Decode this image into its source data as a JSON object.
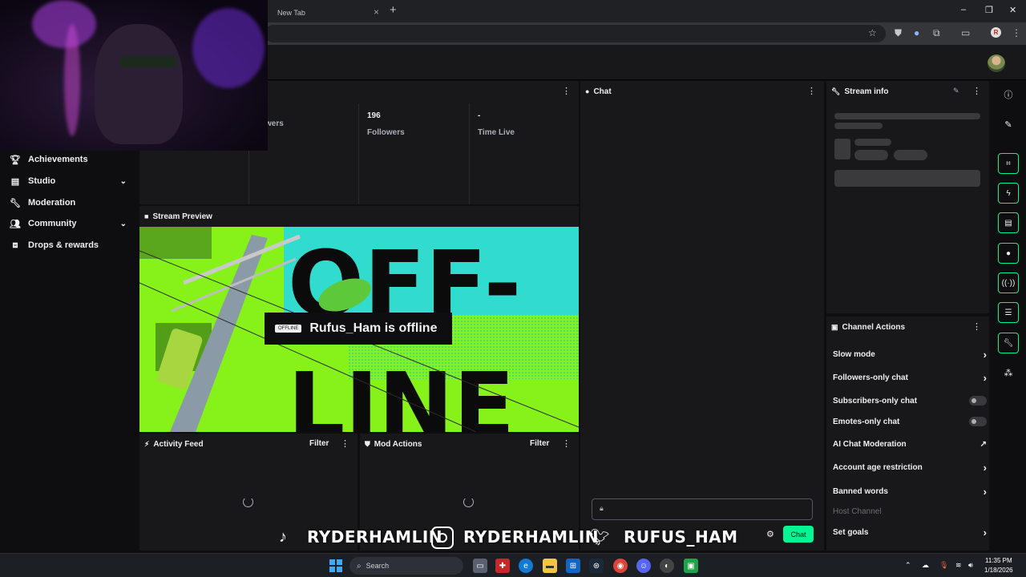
{
  "browser": {
    "tab_title": "New Tab",
    "tab_close": "×",
    "new_tab": "+",
    "window_controls": [
      "–",
      "❐",
      "✕"
    ]
  },
  "stats": [
    {
      "value": "",
      "label": "wers"
    },
    {
      "value": "196",
      "label": "Followers"
    },
    {
      "value": "-",
      "label": "Time Live"
    }
  ],
  "left_nav": [
    {
      "label": "Achievements",
      "icon": "trophy-icon",
      "expandable": false
    },
    {
      "label": "Studio",
      "icon": "studio-icon",
      "expandable": true
    },
    {
      "label": "Moderation",
      "icon": "wrench-icon",
      "expandable": false
    },
    {
      "label": "Community",
      "icon": "community-icon",
      "expandable": true
    },
    {
      "label": "Drops & rewards",
      "icon": "drops-icon",
      "expandable": false
    }
  ],
  "panels": {
    "chat_title": "Chat",
    "stream_info_title": "Stream info",
    "stream_preview_title": "Stream Preview",
    "activity_feed_title": "Activity Feed",
    "mod_actions_title": "Mod Actions",
    "filter_label": "Filter",
    "channel_actions_title": "Channel Actions"
  },
  "preview": {
    "badge": "OFFLINE",
    "message": "Rufus_Ham is offline",
    "bg_text_top": "OFF-",
    "bg_text_bottom": "LINE"
  },
  "channel_actions": [
    {
      "label": "Slow mode",
      "control": "arrow"
    },
    {
      "label": "Followers-only chat",
      "control": "arrow"
    },
    {
      "label": "Subscribers-only chat",
      "control": "toggle",
      "on": false
    },
    {
      "label": "Emotes-only chat",
      "control": "toggle",
      "on": false
    },
    {
      "label": "AI Chat Moderation",
      "control": "external"
    },
    {
      "label": "Account age restriction",
      "control": "arrow"
    },
    {
      "label": "Banned words",
      "control": "arrow"
    },
    {
      "label": "Host Channel",
      "control": "none",
      "disabled": true
    },
    {
      "label": "Set goals",
      "control": "arrow"
    }
  ],
  "chat": {
    "send_label": "Chat"
  },
  "social": {
    "tiktok": "RYDERHAMLIN",
    "instagram": "RYDERHAMLIN",
    "twitter": "RUFUS_HAM"
  },
  "taskbar": {
    "search_label": "Search",
    "time": "11:35 PM",
    "date": "1/18/2026"
  },
  "colors": {
    "accent_green": "#00f593",
    "preview_green": "#86f21a",
    "preview_cyan": "#22d8f0",
    "panel_bg": "#18181b"
  }
}
